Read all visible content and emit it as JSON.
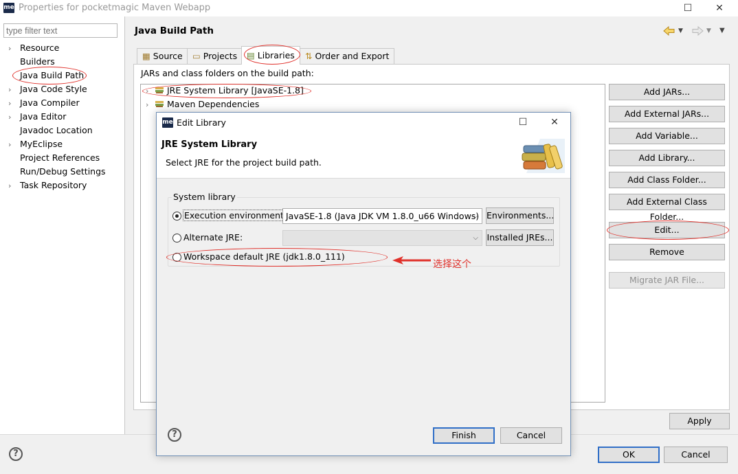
{
  "window": {
    "title": "Properties for pocketmagic Maven Webapp",
    "app_icon": "me"
  },
  "sidebar": {
    "filter_placeholder": "type filter text",
    "items": [
      {
        "label": "Resource",
        "expandable": true
      },
      {
        "label": "Builders",
        "expandable": false
      },
      {
        "label": "Java Build Path",
        "expandable": false,
        "selected": true
      },
      {
        "label": "Java Code Style",
        "expandable": true
      },
      {
        "label": "Java Compiler",
        "expandable": true
      },
      {
        "label": "Java Editor",
        "expandable": true
      },
      {
        "label": "Javadoc Location",
        "expandable": false
      },
      {
        "label": "MyEclipse",
        "expandable": true
      },
      {
        "label": "Project References",
        "expandable": false
      },
      {
        "label": "Run/Debug Settings",
        "expandable": false
      },
      {
        "label": "Task Repository",
        "expandable": true
      }
    ]
  },
  "page": {
    "title": "Java Build Path",
    "tabs": [
      {
        "label": "Source"
      },
      {
        "label": "Projects"
      },
      {
        "label": "Libraries",
        "active": true
      },
      {
        "label": "Order and Export"
      }
    ],
    "jars_label": "JARs and class folders on the build path:",
    "libraries": [
      {
        "label": "JRE System Library [JavaSE-1.8]"
      },
      {
        "label": "Maven Dependencies"
      }
    ],
    "buttons": {
      "add_jars": "Add JARs...",
      "add_external_jars": "Add External JARs...",
      "add_variable": "Add Variable...",
      "add_library": "Add Library...",
      "add_class_folder": "Add Class Folder...",
      "add_external_class_folder": "Add External Class Folder...",
      "edit": "Edit...",
      "remove": "Remove",
      "migrate": "Migrate JAR File...",
      "apply": "Apply"
    }
  },
  "footer": {
    "ok": "OK",
    "cancel": "Cancel"
  },
  "dialog": {
    "title": "Edit Library",
    "heading": "JRE System Library",
    "description": "Select JRE for the project build path.",
    "group_label": "System library",
    "exec_env_label": "Execution environment:",
    "exec_env_value": "JavaSE-1.8 (Java JDK VM 1.8.0_u66 Windows)",
    "environments_button": "Environments...",
    "alternate_jre_label": "Alternate JRE:",
    "installed_jres_button": "Installed JREs...",
    "workspace_default_label": "Workspace default JRE (jdk1.8.0_111)",
    "finish": "Finish",
    "cancel": "Cancel",
    "selected_option": "execution_environment"
  },
  "annotation": {
    "text": "选择这个",
    "color": "#e0302a"
  },
  "colors": {
    "accent_border": "#2f6ec7",
    "annotation_red": "#e0302a"
  }
}
